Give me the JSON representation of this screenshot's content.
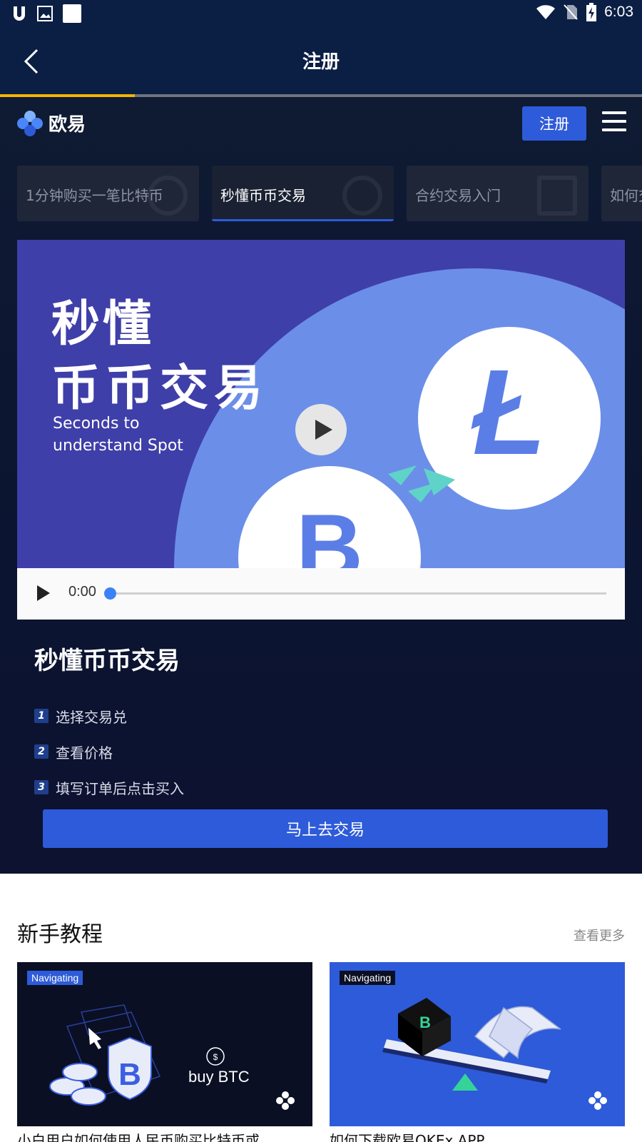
{
  "status_bar": {
    "time": "6:03"
  },
  "app_bar": {
    "title": "注册"
  },
  "page_progress": 0.21,
  "site_nav": {
    "logo_text": "欧易",
    "register_label": "注册"
  },
  "tabs": [
    {
      "label": "1分钟购买一笔比特币",
      "active": false
    },
    {
      "label": "秒懂币币交易",
      "active": true
    },
    {
      "label": "合约交易入门",
      "active": false
    },
    {
      "label": "如何交",
      "active": false
    }
  ],
  "video": {
    "title_line1": "秒懂",
    "title_line2": "币币交易",
    "subtitle": "Seconds to\nunderstand Spot",
    "time": "0:00",
    "played_fraction": 0
  },
  "course": {
    "title": "秒懂币币交易",
    "steps": [
      {
        "num": "1",
        "text": "选择交易兑"
      },
      {
        "num": "2",
        "text": "查看价格"
      },
      {
        "num": "3",
        "text": "填写订单后点击买入"
      }
    ],
    "cta_label": "马上去交易"
  },
  "tutorials": {
    "title": "新手教程",
    "more_label": "查看更多",
    "cards": [
      {
        "badge": "Navigating",
        "art_text": "buy BTC",
        "caption": "小白用户如何使用人民币购买比特币或"
      },
      {
        "badge": "Navigating",
        "caption": "如何下载欧易OKEx APP"
      }
    ]
  },
  "colors": {
    "accent": "#2d5bd9",
    "nav_dark": "#0b1f45",
    "hero_dark": "#0f1a33",
    "video_bg": "#3f3fa9",
    "video_circle": "#6b8fe8",
    "progress": "#f4b400"
  }
}
